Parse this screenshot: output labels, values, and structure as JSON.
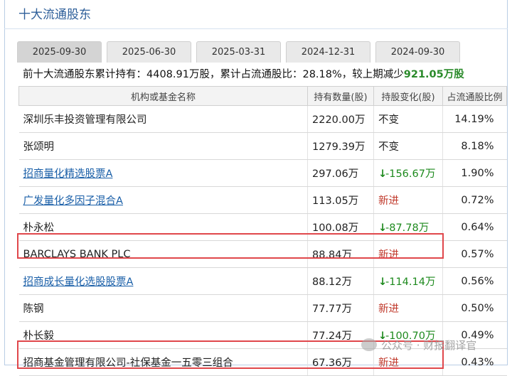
{
  "section_title": "十大流通股东",
  "tabs": [
    "2025-09-30",
    "2025-06-30",
    "2025-03-31",
    "2024-12-31",
    "2024-09-30"
  ],
  "active_tab": "2025-09-30",
  "summary": {
    "prefix": "前十大流通股东累计持有：",
    "total_hold": "4408.91万股",
    "mid": "，累计占流通股比：",
    "ratio": "28.18%",
    "tail": "，较上期减少",
    "change": "921.05万股"
  },
  "columns": {
    "name": "机构或基金名称",
    "hold": "持有数量(股)",
    "change": "持股变化(股)",
    "ratio": "占流通股比例"
  },
  "rows": [
    {
      "name": "深圳乐丰投资管理有限公司",
      "link": false,
      "hold": "2220.00万",
      "change": "不变",
      "change_type": "same",
      "ratio": "14.19%"
    },
    {
      "name": "张颂明",
      "link": false,
      "hold": "1279.39万",
      "change": "不变",
      "change_type": "same",
      "ratio": "8.18%"
    },
    {
      "name": "招商量化精选股票A",
      "link": true,
      "hold": "297.06万",
      "change": "-156.67万",
      "change_type": "down",
      "ratio": "1.90%"
    },
    {
      "name": "广发量化多因子混合A",
      "link": true,
      "hold": "113.05万",
      "change": "新进",
      "change_type": "new",
      "ratio": "0.72%"
    },
    {
      "name": "朴永松",
      "link": false,
      "hold": "100.08万",
      "change": "-87.78万",
      "change_type": "down",
      "ratio": "0.64%"
    },
    {
      "name": "BARCLAYS BANK PLC",
      "link": false,
      "hold": "88.84万",
      "change": "新进",
      "change_type": "new",
      "ratio": "0.57%"
    },
    {
      "name": "招商成长量化选股股票A",
      "link": true,
      "hold": "88.12万",
      "change": "-114.14万",
      "change_type": "down",
      "ratio": "0.56%"
    },
    {
      "name": "陈钢",
      "link": false,
      "hold": "77.77万",
      "change": "新进",
      "change_type": "new",
      "ratio": "0.50%"
    },
    {
      "name": "朴长毅",
      "link": false,
      "hold": "77.24万",
      "change": "-100.70万",
      "change_type": "down",
      "ratio": "0.49%"
    },
    {
      "name": "招商基金管理有限公司-社保基金一五零三组合",
      "link": false,
      "hold": "67.36万",
      "change": "新进",
      "change_type": "new",
      "ratio": "0.43%"
    }
  ],
  "colors": {
    "down": "#1e8a1e",
    "new": "#c0392b",
    "link": "#1a5fa8",
    "highlight_box": "#e0474b"
  },
  "watermark": "公众号 · 财报翻译官"
}
